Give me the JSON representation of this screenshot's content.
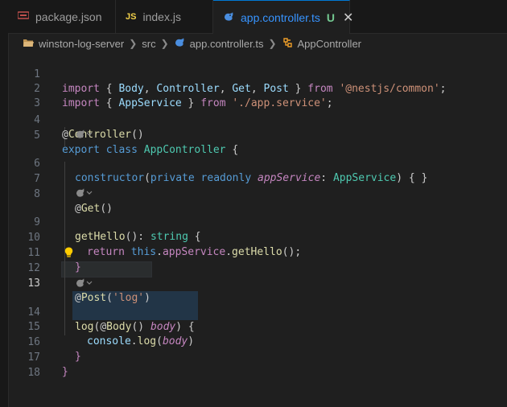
{
  "tabs": [
    {
      "icon": "json-icon",
      "label": "package.json",
      "active": false
    },
    {
      "icon": "js-icon",
      "icon_text": "JS",
      "label": "index.js",
      "active": false
    },
    {
      "icon": "nest-icon",
      "label": "app.controller.ts",
      "git_status": "U",
      "active": true
    }
  ],
  "breadcrumbs": [
    "winston-log-server",
    "src",
    "app.controller.ts",
    "AppController"
  ],
  "editor": {
    "current_line": 13,
    "line_numbers": [
      "1",
      "2",
      "3",
      "4",
      "5",
      "6",
      "7",
      "8",
      "9",
      "10",
      "11",
      "12",
      "13",
      "14",
      "15",
      "16",
      "17",
      "18"
    ],
    "code": {
      "l1": {
        "import": "import",
        "ob": " { ",
        "body": "Body",
        "c1": ", ",
        "controller": "Controller",
        "c2": ", ",
        "get": "Get",
        "c3": ", ",
        "post": "Post",
        "cb": " } ",
        "from": "from",
        "sp": " ",
        "mod": "'@nestjs/common'",
        "semi": ";"
      },
      "l2": {
        "import": "import",
        "ob": " { ",
        "svc": "AppService",
        "cb": " } ",
        "from": "from",
        "sp": " ",
        "mod": "'./app.service'",
        "semi": ";"
      },
      "l4": {
        "at": "@",
        "dec": "Controller",
        "p": "()"
      },
      "l5": {
        "export": "export",
        "sp1": " ",
        "class": "class",
        "sp2": " ",
        "name": "AppController",
        "ob": " {"
      },
      "l6": {
        "ctor": "constructor",
        "op": "(",
        "private": "private",
        "sp1": " ",
        "readonly": "readonly",
        "sp2": " ",
        "param": "appService",
        "colon": ": ",
        "type": "AppService",
        "cp": ")",
        "body": " { }"
      },
      "l8": {
        "at": "@",
        "dec": "Get",
        "p": "()"
      },
      "l9": {
        "fn": "getHello",
        "p": "(): ",
        "type": "string",
        "ob": " {"
      },
      "l10": {
        "ret": "return",
        "sp": " ",
        "this": "this",
        "dot": ".",
        "prop": "appService",
        "dot2": ".",
        "call": "getHello",
        "p": "();"
      },
      "l11": {
        "cb": "}"
      },
      "l13": {
        "at": "@",
        "dec": "Post",
        "op": "(",
        "str": "'log'",
        "cp": ")"
      },
      "l14": {
        "fn": "log",
        "op": "(",
        "at": "@",
        "dec": "Body",
        "p": "() ",
        "param": "body",
        "cp": ")",
        "ob": " {"
      },
      "l15": {
        "obj": "console",
        "dot": ".",
        "call": "log",
        "op": "(",
        "arg": "body",
        "cp": ")"
      },
      "l16": {
        "cb": "}"
      },
      "l17": {
        "cb": "}"
      }
    }
  }
}
